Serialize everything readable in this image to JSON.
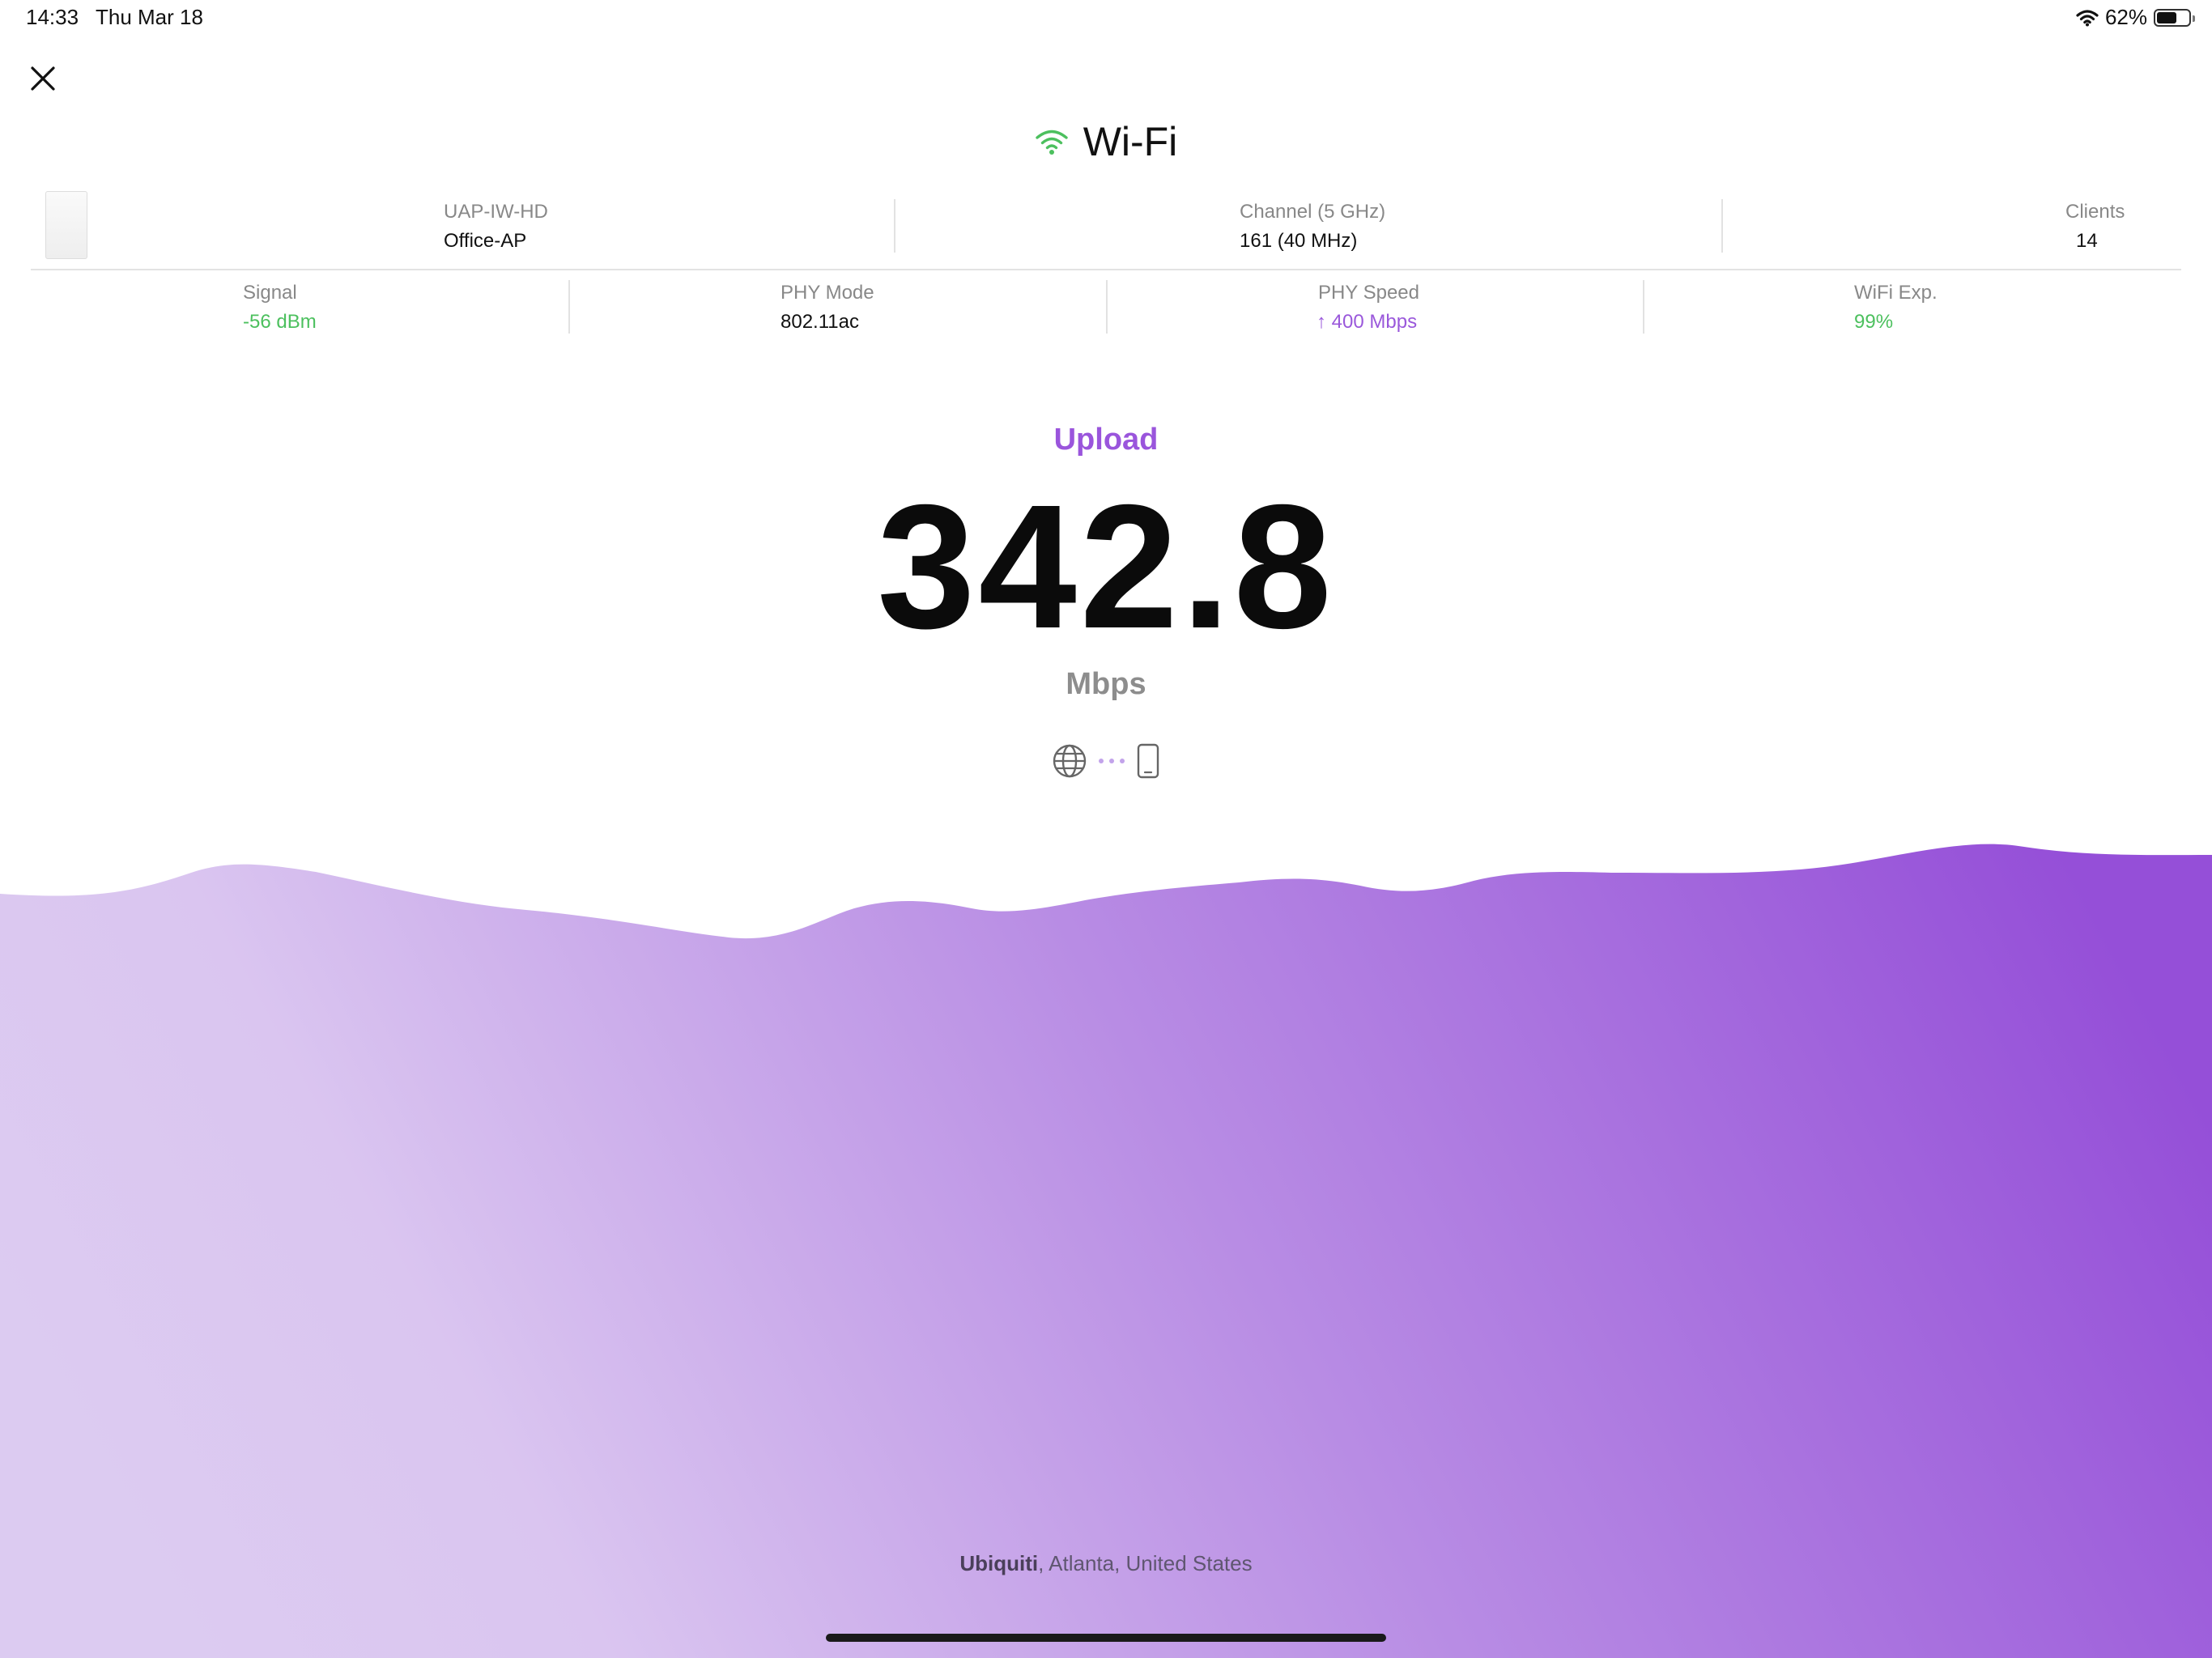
{
  "status_bar": {
    "time": "14:33",
    "date": "Thu Mar 18",
    "battery_percent": "62%",
    "battery_level": 0.62
  },
  "header": {
    "title": "Wi-Fi"
  },
  "device": {
    "model": "UAP-IW-HD",
    "name": "Office-AP"
  },
  "channel": {
    "label": "Channel (5 GHz)",
    "value": "161 (40 MHz)"
  },
  "clients": {
    "label": "Clients",
    "value": "14"
  },
  "stats": {
    "signal": {
      "label": "Signal",
      "value": "-56 dBm"
    },
    "phy_mode": {
      "label": "PHY Mode",
      "value": "802.11ac"
    },
    "phy_speed": {
      "label": "PHY Speed",
      "arrow": "↑",
      "value": "400 Mbps"
    },
    "wifi_exp": {
      "label": "WiFi Exp.",
      "value": "99%"
    }
  },
  "test": {
    "phase": "Upload",
    "value": "342.8",
    "unit": "Mbps"
  },
  "server": {
    "provider": "Ubiquiti",
    "location": ", Atlanta, United States"
  },
  "icons": {
    "close": "close-icon",
    "wifi": "wifi-icon",
    "globe": "globe-icon",
    "phone": "phone-icon"
  },
  "colors": {
    "accent_purple": "#9a55dc",
    "success_green": "#4cc05e",
    "wave_light": "#dccbf1",
    "wave_dark": "#954fd8"
  }
}
